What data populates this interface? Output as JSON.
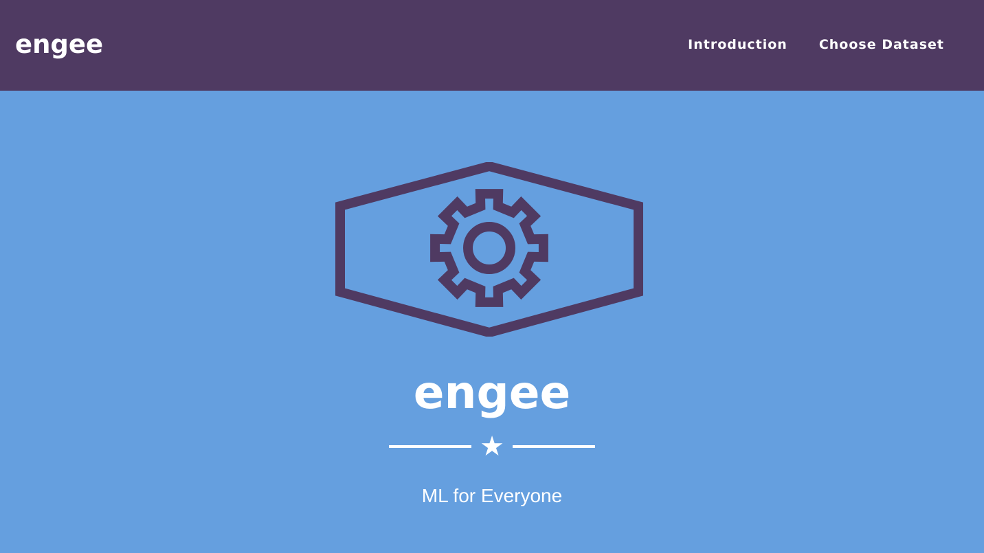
{
  "navbar": {
    "brand": "engee",
    "links": [
      {
        "label": "Introduction"
      },
      {
        "label": "Choose Dataset"
      }
    ],
    "background_color": "#4f3a62"
  },
  "masthead": {
    "logo_icon": "gear-in-hexagon-icon",
    "title": "engee",
    "divider_icon": "star-icon",
    "subtitle": "ML for Everyone",
    "background_color": "#659fdf",
    "logo_color": "#4f3a62"
  }
}
